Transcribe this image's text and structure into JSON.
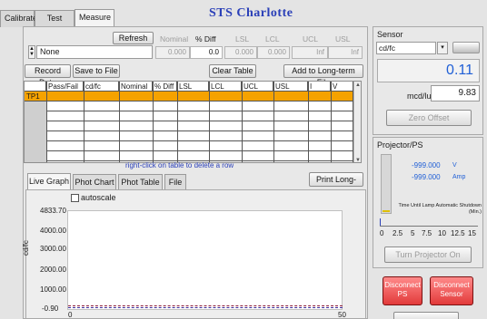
{
  "window": {
    "title": "STS Charlotte"
  },
  "tabs": [
    {
      "label": "Calibrate"
    },
    {
      "label": "Test Info"
    },
    {
      "label": "Measure"
    }
  ],
  "limits": {
    "refresh_label": "Refresh",
    "selector_value": "None",
    "headers": [
      "Nominal",
      "% Diff",
      "LSL",
      "LCL",
      "UCL",
      "USL"
    ],
    "values": [
      "0.000",
      "0.0",
      "0.000",
      "0.000",
      "Inf",
      "Inf"
    ]
  },
  "toolbar": {
    "record_label": "Record Data",
    "save_label": "Save to File",
    "clear_label": "Clear Table",
    "add_label": "Add to Long-term File"
  },
  "table": {
    "columns": [
      "",
      "Pass/Fail",
      "cd/fc",
      "Nominal",
      "% Diff",
      "LSL",
      "LCL",
      "UCL",
      "USL",
      "I",
      "V"
    ],
    "rows": [
      [
        "TP1",
        "",
        "",
        "",
        "",
        "",
        "",
        "",
        "",
        "",
        ""
      ]
    ],
    "hint": "right-click on table to delete a row"
  },
  "bottom_tabs": [
    {
      "label": "Live Graph"
    },
    {
      "label": "Phot Chart"
    },
    {
      "label": "Phot Table"
    },
    {
      "label": "File"
    }
  ],
  "print_label": "Print Long-term",
  "graph": {
    "autoscale_label": "autoscale",
    "y_axis_label": "cd/fc",
    "y_ticks": [
      "4833.70",
      "4000.00",
      "3000.00",
      "2000.00",
      "1000.00",
      "-0.90"
    ],
    "x_ticks": [
      "0",
      "50"
    ]
  },
  "sensor": {
    "title": "Sensor",
    "unit_value": "cd/fc",
    "reading": "0.11",
    "mcd_label": "mcd/lux",
    "mcd_value": "9.83",
    "zero_label": "Zero Offset"
  },
  "projector": {
    "title": "Projector/PS",
    "volt_value": "-999.000",
    "volt_unit": "V",
    "amp_value": "-999.000",
    "amp_unit": "Amp",
    "timer_label": "Time Until Lamp Automatic Shutdown (Min.)",
    "slider_ticks": [
      "0",
      "2.5",
      "5",
      "7.5",
      "10",
      "12.5",
      "15"
    ],
    "turn_on_label": "Turn Projector On"
  },
  "disconnect": {
    "ps_label_1": "Disconnect",
    "ps_label_2": "PS",
    "sensor_label_1": "Disconnect",
    "sensor_label_2": "Sensor"
  },
  "colors": {
    "title_blue": "#2a3fb8",
    "row_highlight": "#f5a200",
    "reading_blue": "#1f5fd6",
    "disconnect_red": "#e23a3a"
  }
}
